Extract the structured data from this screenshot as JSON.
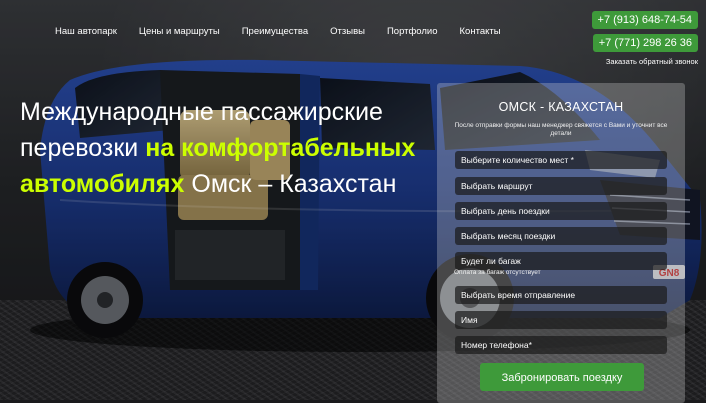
{
  "nav": {
    "items": [
      "Наш автопарк",
      "Цены и маршруты",
      "Преимущества",
      "Отзывы",
      "Портфолио",
      "Контакты"
    ]
  },
  "contacts": {
    "phone1": "+7 (913) 648-74-54",
    "phone2": "+7 (771) 298 26 36",
    "callback": "Заказать обратный звонок"
  },
  "hero": {
    "line1": "Международные пассажирские",
    "line2_plain": "перевозки ",
    "line2_highlight": "на комфортабельных",
    "line3_highlight": "автомобилях",
    "line3_plain": " Омск – Казахстан",
    "badge": "GN8"
  },
  "form": {
    "title": "ОМСК - КАЗАХСТАН",
    "subtitle": "После отправки формы наш менеджер свяжется с Вами и уточнит все детали",
    "seats": "Выберите количество мест *",
    "route": "Выбрать маршрут",
    "day": "Выбрать день поездки",
    "month": "Выбрать месяц поездки",
    "luggage": "Будет ли багаж",
    "luggage_note": "Оплата за багаж отсутствует",
    "time": "Выбрать время отправление",
    "name_placeholder": "Имя",
    "phone_placeholder": "Номер телефона*",
    "submit": "Забронировать поездку"
  },
  "colors": {
    "accent_green": "#3e9a3a",
    "highlight": "#ccff00",
    "van_blue": "#1f3d8f"
  }
}
